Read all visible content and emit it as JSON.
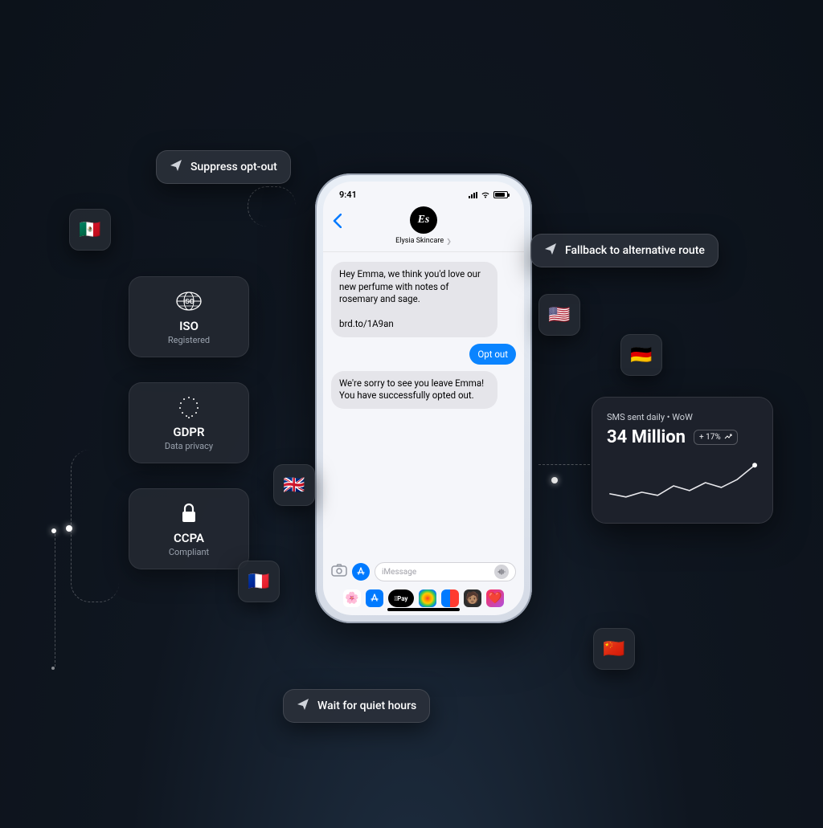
{
  "phone": {
    "time": "9:41",
    "contact_name": "Elysia Skincare",
    "avatar_text": "Es",
    "msg1": "Hey Emma, we think you'd love our new perfume with notes of rosemary and sage.",
    "msg1_link": "brd.to/1A9an",
    "msg_reply": "Opt out",
    "msg2": "We're sorry to see you leave Emma! You have successfully opted out.",
    "input_placeholder": "iMessage",
    "dock_pay_label": "Pay"
  },
  "pills": {
    "suppress": "Suppress opt-out",
    "fallback": "Fallback to alternative route",
    "quiet": "Wait for quiet hours"
  },
  "compliance": {
    "iso": {
      "title": "ISO",
      "sub": "Registered"
    },
    "gdpr": {
      "title": "GDPR",
      "sub": "Data privacy"
    },
    "ccpa": {
      "title": "CCPA",
      "sub": "Compliant"
    }
  },
  "flags": {
    "mx": "🇲🇽",
    "uk": "🇬🇧",
    "fr": "🇫🇷",
    "us": "🇺🇸",
    "de": "🇩🇪",
    "cn": "🇨🇳"
  },
  "stats": {
    "label": "SMS sent daily • WoW",
    "value": "34 Million",
    "change": "+ 17%"
  },
  "chart_data": {
    "type": "line",
    "title": "SMS sent daily • WoW",
    "ylabel": "",
    "xlabel": "",
    "x": [
      0,
      1,
      2,
      3,
      4,
      5,
      6,
      7,
      8,
      9
    ],
    "values": [
      30,
      25,
      32,
      28,
      38,
      33,
      40,
      36,
      42,
      58
    ],
    "ylim": [
      20,
      60
    ],
    "note": "decorative sparkline with upward trend"
  }
}
